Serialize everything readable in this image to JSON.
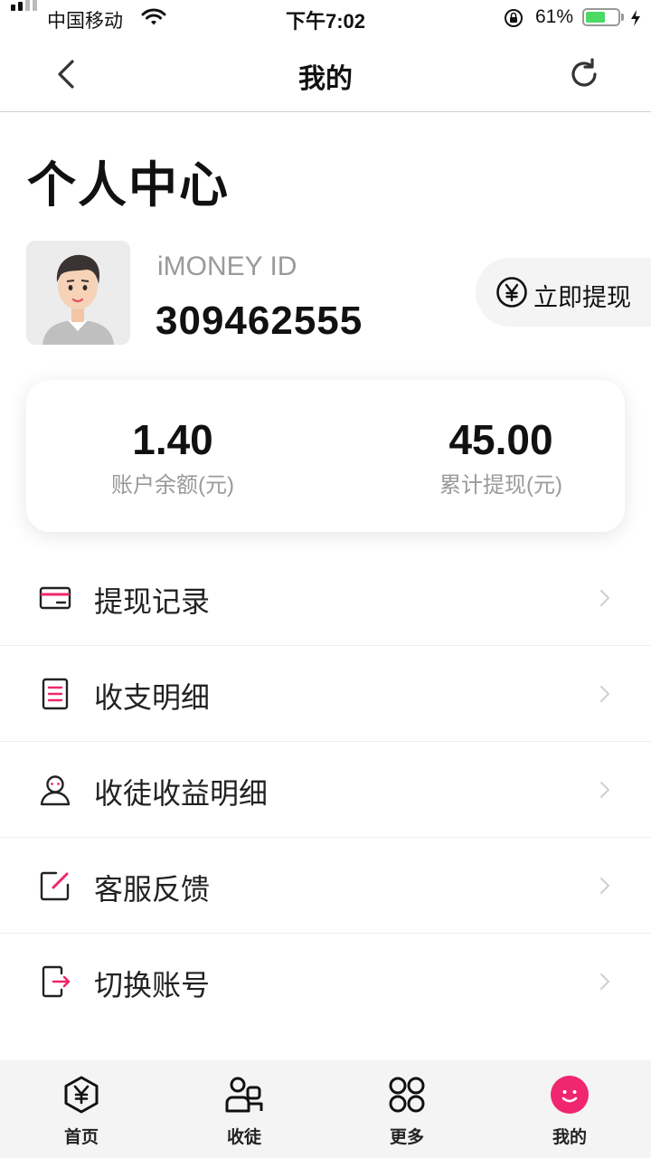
{
  "status_bar": {
    "carrier": "中国移动",
    "time": "下午7:02",
    "battery_percent": "61%",
    "battery_level": 0.61,
    "battery_color": "#4cd964"
  },
  "nav": {
    "title": "我的",
    "back_icon": "chevron-left-icon",
    "refresh_icon": "refresh-icon"
  },
  "page_title": "个人中心",
  "profile": {
    "id_label": "iMONEY ID",
    "id_value": "309462555",
    "withdraw_button": "立即提现",
    "withdraw_icon": "yen-circle-icon"
  },
  "stats": {
    "balance": {
      "value": "1.40",
      "label": "账户余额(元)"
    },
    "total_withdrawn": {
      "value": "45.00",
      "label": "累计提现(元)"
    }
  },
  "menu": [
    {
      "label": "提现记录",
      "icon": "card-icon"
    },
    {
      "label": "收支明细",
      "icon": "document-list-icon"
    },
    {
      "label": "收徒收益明细",
      "icon": "user-icon"
    },
    {
      "label": "客服反馈",
      "icon": "edit-icon"
    },
    {
      "label": "切换账号",
      "icon": "logout-icon"
    }
  ],
  "tabbar": [
    {
      "label": "首页",
      "icon": "yen-hexagon-icon",
      "active": false
    },
    {
      "label": "收徒",
      "icon": "people-icon",
      "active": false
    },
    {
      "label": "更多",
      "icon": "grid-icon",
      "active": false
    },
    {
      "label": "我的",
      "icon": "smiley-icon",
      "active": true
    }
  ],
  "colors": {
    "accent": "#f0266f",
    "text": "#111111",
    "muted": "#9a9a9a"
  }
}
